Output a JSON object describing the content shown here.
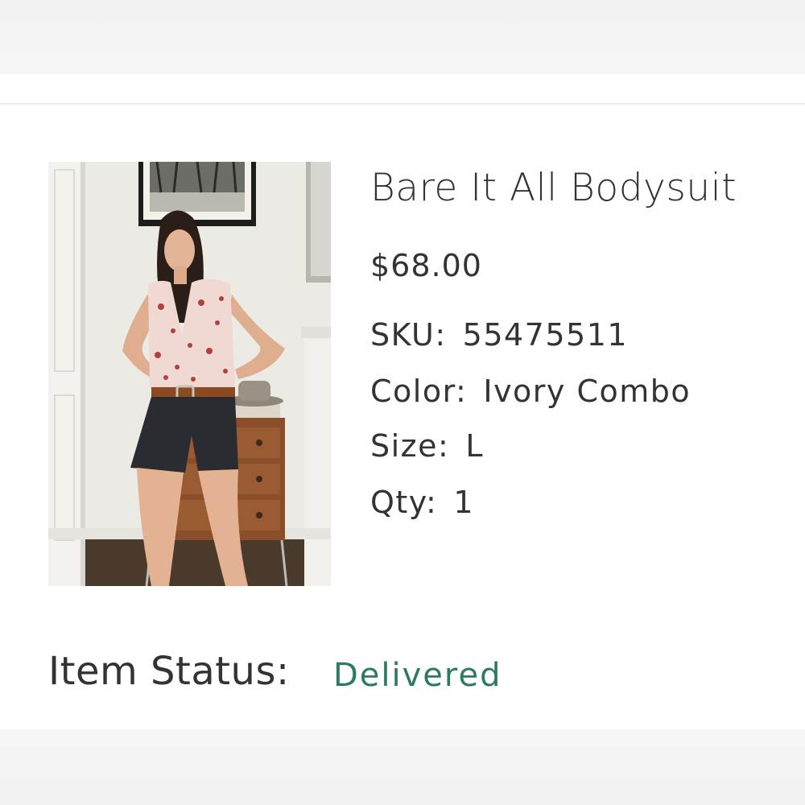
{
  "product": {
    "name": "Bare It All Bodysuit",
    "price": "$68.00",
    "sku_label": "SKU:",
    "sku": "55475511",
    "color_label": "Color:",
    "color": "Ivory Combo",
    "size_label": "Size:",
    "size": "L",
    "qty_label": "Qty:",
    "qty": "1"
  },
  "status": {
    "label": "Item Status:",
    "value": "Delivered"
  },
  "colors": {
    "text": "#333333",
    "status_green": "#2c7a5f",
    "divider": "#ececec"
  }
}
